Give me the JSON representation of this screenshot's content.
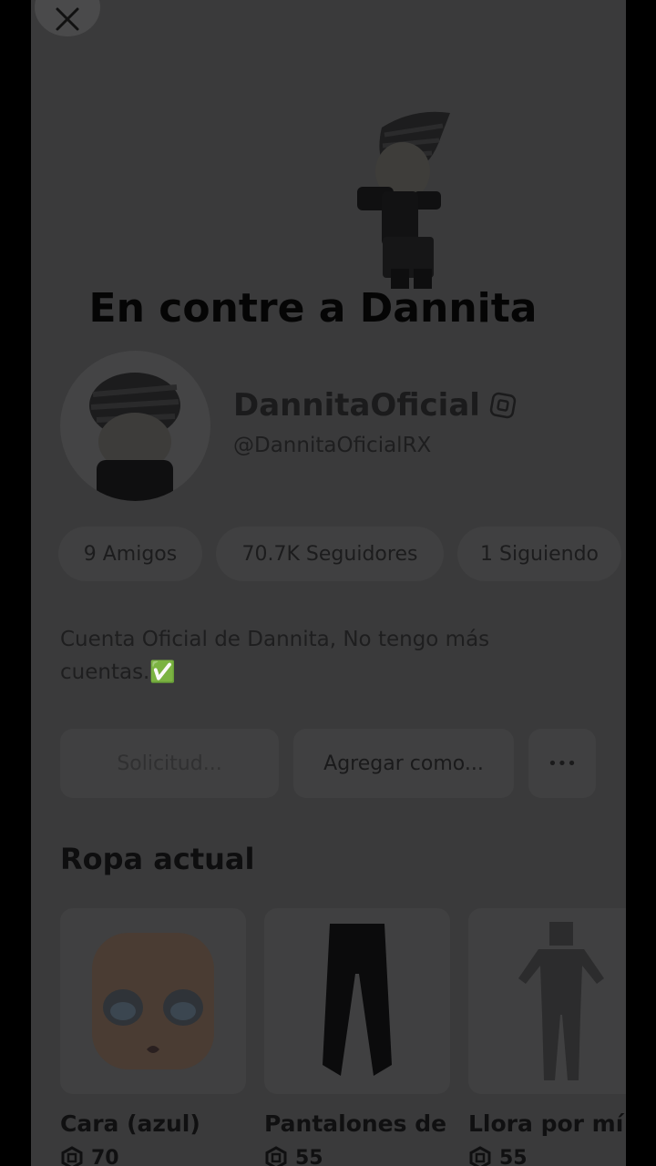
{
  "caption": "En contre a Dannita",
  "profile": {
    "display_name": "DannitaOficial",
    "username": "@DannitaOficialRX",
    "bio": "Cuenta Oficial de Dannita, No tengo más cuentas.✅"
  },
  "stats": {
    "friends": "9 Amigos",
    "followers": "70.7K Seguidores",
    "following": "1 Siguiendo"
  },
  "actions": {
    "request": "Solicitud...",
    "add_friend": "Agregar como...",
    "more": "•••"
  },
  "outfit": {
    "title": "Ropa actual",
    "items": [
      {
        "name": "Cara (azul)",
        "price": "70"
      },
      {
        "name": "Pantalones de",
        "price": "55"
      },
      {
        "name": "Llora por mí",
        "price": "55"
      }
    ]
  },
  "colors": {
    "overlay_bg": "#3a3a3b",
    "letterbox": "#000000"
  }
}
